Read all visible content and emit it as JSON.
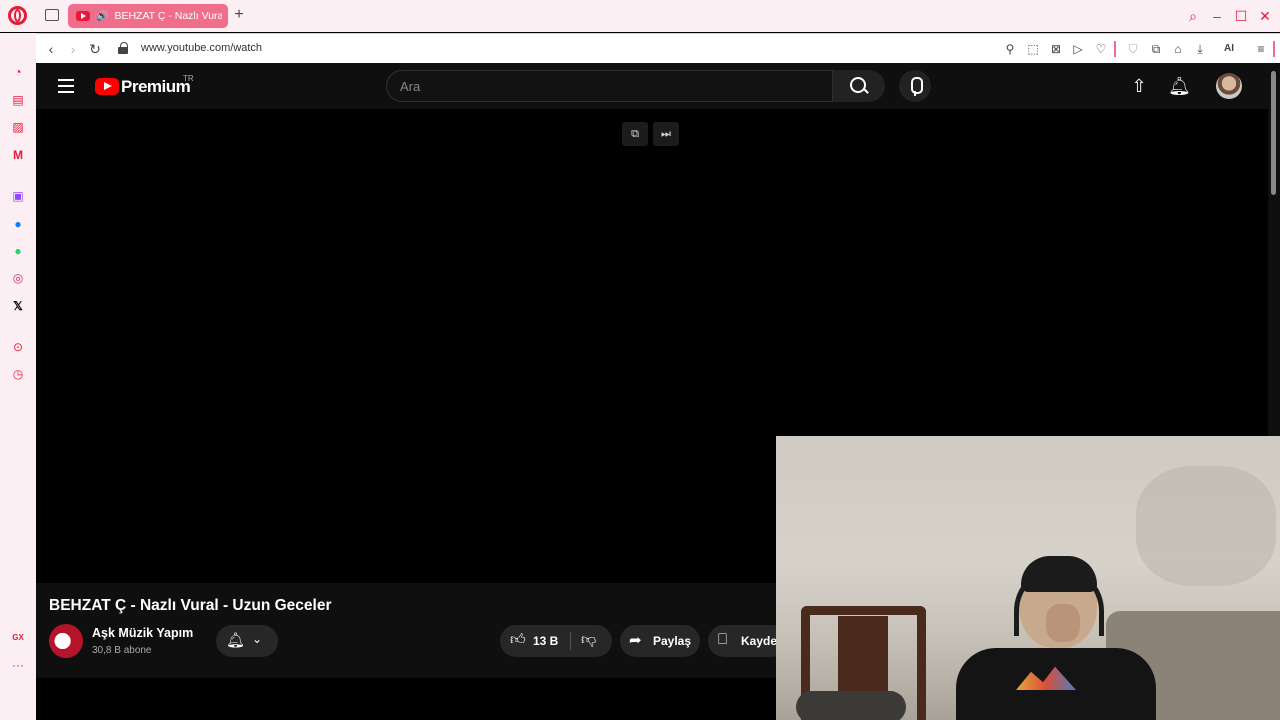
{
  "browser": {
    "tab_title": "BEHZAT Ç - Nazlı Vural",
    "new_tab": "+",
    "url": "www.youtube.com/watch",
    "ai_label": "AI",
    "sidebar_gx_label": "GX",
    "sidebar_more": "···",
    "accent_color": "#e81a3b"
  },
  "youtube": {
    "brand": "Premium",
    "country_code": "TR",
    "search_placeholder": "Ara",
    "video_title": "BEHZAT Ç - Nazlı Vural - Uzun Geceler",
    "channel_name": "Aşk Müzik Yapım",
    "subscribers": "30,8 B abone",
    "likes": "13 B",
    "share_label": "Paylaş",
    "save_label": "Kaydet"
  }
}
